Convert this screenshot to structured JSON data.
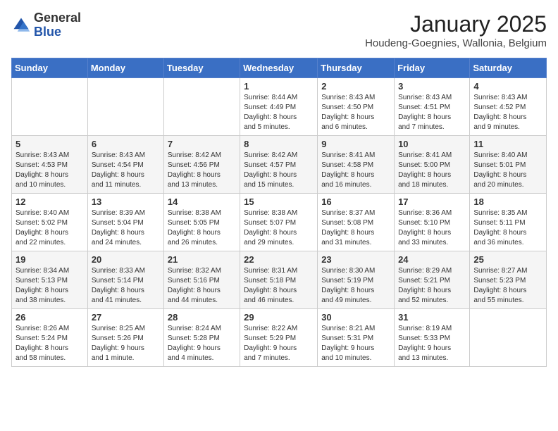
{
  "header": {
    "logo_general": "General",
    "logo_blue": "Blue",
    "month_title": "January 2025",
    "location": "Houdeng-Goegnies, Wallonia, Belgium"
  },
  "days_of_week": [
    "Sunday",
    "Monday",
    "Tuesday",
    "Wednesday",
    "Thursday",
    "Friday",
    "Saturday"
  ],
  "weeks": [
    [
      {
        "day": "",
        "info": ""
      },
      {
        "day": "",
        "info": ""
      },
      {
        "day": "",
        "info": ""
      },
      {
        "day": "1",
        "info": "Sunrise: 8:44 AM\nSunset: 4:49 PM\nDaylight: 8 hours\nand 5 minutes."
      },
      {
        "day": "2",
        "info": "Sunrise: 8:43 AM\nSunset: 4:50 PM\nDaylight: 8 hours\nand 6 minutes."
      },
      {
        "day": "3",
        "info": "Sunrise: 8:43 AM\nSunset: 4:51 PM\nDaylight: 8 hours\nand 7 minutes."
      },
      {
        "day": "4",
        "info": "Sunrise: 8:43 AM\nSunset: 4:52 PM\nDaylight: 8 hours\nand 9 minutes."
      }
    ],
    [
      {
        "day": "5",
        "info": "Sunrise: 8:43 AM\nSunset: 4:53 PM\nDaylight: 8 hours\nand 10 minutes."
      },
      {
        "day": "6",
        "info": "Sunrise: 8:43 AM\nSunset: 4:54 PM\nDaylight: 8 hours\nand 11 minutes."
      },
      {
        "day": "7",
        "info": "Sunrise: 8:42 AM\nSunset: 4:56 PM\nDaylight: 8 hours\nand 13 minutes."
      },
      {
        "day": "8",
        "info": "Sunrise: 8:42 AM\nSunset: 4:57 PM\nDaylight: 8 hours\nand 15 minutes."
      },
      {
        "day": "9",
        "info": "Sunrise: 8:41 AM\nSunset: 4:58 PM\nDaylight: 8 hours\nand 16 minutes."
      },
      {
        "day": "10",
        "info": "Sunrise: 8:41 AM\nSunset: 5:00 PM\nDaylight: 8 hours\nand 18 minutes."
      },
      {
        "day": "11",
        "info": "Sunrise: 8:40 AM\nSunset: 5:01 PM\nDaylight: 8 hours\nand 20 minutes."
      }
    ],
    [
      {
        "day": "12",
        "info": "Sunrise: 8:40 AM\nSunset: 5:02 PM\nDaylight: 8 hours\nand 22 minutes."
      },
      {
        "day": "13",
        "info": "Sunrise: 8:39 AM\nSunset: 5:04 PM\nDaylight: 8 hours\nand 24 minutes."
      },
      {
        "day": "14",
        "info": "Sunrise: 8:38 AM\nSunset: 5:05 PM\nDaylight: 8 hours\nand 26 minutes."
      },
      {
        "day": "15",
        "info": "Sunrise: 8:38 AM\nSunset: 5:07 PM\nDaylight: 8 hours\nand 29 minutes."
      },
      {
        "day": "16",
        "info": "Sunrise: 8:37 AM\nSunset: 5:08 PM\nDaylight: 8 hours\nand 31 minutes."
      },
      {
        "day": "17",
        "info": "Sunrise: 8:36 AM\nSunset: 5:10 PM\nDaylight: 8 hours\nand 33 minutes."
      },
      {
        "day": "18",
        "info": "Sunrise: 8:35 AM\nSunset: 5:11 PM\nDaylight: 8 hours\nand 36 minutes."
      }
    ],
    [
      {
        "day": "19",
        "info": "Sunrise: 8:34 AM\nSunset: 5:13 PM\nDaylight: 8 hours\nand 38 minutes."
      },
      {
        "day": "20",
        "info": "Sunrise: 8:33 AM\nSunset: 5:14 PM\nDaylight: 8 hours\nand 41 minutes."
      },
      {
        "day": "21",
        "info": "Sunrise: 8:32 AM\nSunset: 5:16 PM\nDaylight: 8 hours\nand 44 minutes."
      },
      {
        "day": "22",
        "info": "Sunrise: 8:31 AM\nSunset: 5:18 PM\nDaylight: 8 hours\nand 46 minutes."
      },
      {
        "day": "23",
        "info": "Sunrise: 8:30 AM\nSunset: 5:19 PM\nDaylight: 8 hours\nand 49 minutes."
      },
      {
        "day": "24",
        "info": "Sunrise: 8:29 AM\nSunset: 5:21 PM\nDaylight: 8 hours\nand 52 minutes."
      },
      {
        "day": "25",
        "info": "Sunrise: 8:27 AM\nSunset: 5:23 PM\nDaylight: 8 hours\nand 55 minutes."
      }
    ],
    [
      {
        "day": "26",
        "info": "Sunrise: 8:26 AM\nSunset: 5:24 PM\nDaylight: 8 hours\nand 58 minutes."
      },
      {
        "day": "27",
        "info": "Sunrise: 8:25 AM\nSunset: 5:26 PM\nDaylight: 9 hours\nand 1 minute."
      },
      {
        "day": "28",
        "info": "Sunrise: 8:24 AM\nSunset: 5:28 PM\nDaylight: 9 hours\nand 4 minutes."
      },
      {
        "day": "29",
        "info": "Sunrise: 8:22 AM\nSunset: 5:29 PM\nDaylight: 9 hours\nand 7 minutes."
      },
      {
        "day": "30",
        "info": "Sunrise: 8:21 AM\nSunset: 5:31 PM\nDaylight: 9 hours\nand 10 minutes."
      },
      {
        "day": "31",
        "info": "Sunrise: 8:19 AM\nSunset: 5:33 PM\nDaylight: 9 hours\nand 13 minutes."
      },
      {
        "day": "",
        "info": ""
      }
    ]
  ]
}
